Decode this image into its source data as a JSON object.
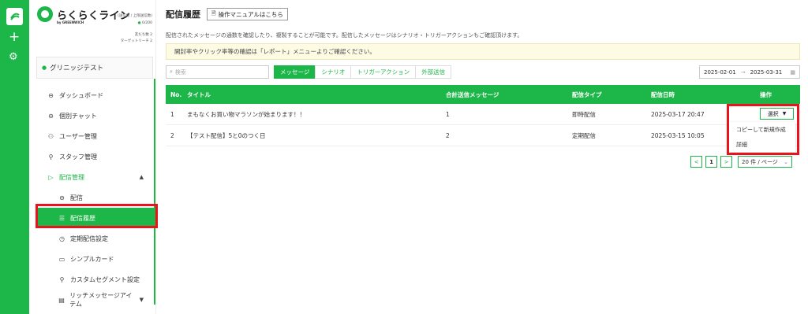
{
  "rail": {
    "logo_text": "GREENWICH",
    "plus_icon": "+",
    "gear_icon": "⚙"
  },
  "brand": {
    "name": "らくらくライン",
    "sub": "by GREENWICH"
  },
  "account": {
    "label_line1": "(送信数 / 上限送信数)",
    "quota": "0/200",
    "friends_label": "友だち数 2",
    "target_label": "ターゲットリーチ 2"
  },
  "workspace": "グリニッジテスト",
  "menu": [
    {
      "label": "ダッシュボード",
      "icon": "⊖"
    },
    {
      "label": "個別チャット",
      "icon": "⊖"
    },
    {
      "label": "ユーザー管理",
      "icon": "⚇"
    },
    {
      "label": "スタッフ管理",
      "icon": "⚲"
    },
    {
      "label": "配信管理",
      "icon": "▷"
    },
    {
      "label": "配信",
      "icon": "⊖"
    },
    {
      "label": "配信履歴",
      "icon": "☰"
    },
    {
      "label": "定期配信設定",
      "icon": "◷"
    },
    {
      "label": "シンプルカード",
      "icon": "▭"
    },
    {
      "label": "カスタムセグメント設定",
      "icon": "⚲"
    },
    {
      "label": "リッチメッセージアイテム",
      "icon": "▤"
    }
  ],
  "page": {
    "title": "配信履歴",
    "manual_button": "操作マニュアルはこちら",
    "description": "配信されたメッセージの通数を確認したり、複製することが可能です。配信したメッセージはシナリオ・トリガーアクションもご確認頂けます。",
    "notice": "開封率やクリック率等の確認は「レポート」メニューよりご確認ください。"
  },
  "search": {
    "placeholder": "検索"
  },
  "tabs": [
    "メッセージ",
    "シナリオ",
    "トリガーアクション",
    "外部送信"
  ],
  "daterange": {
    "start": "2025-02-01",
    "end": "2025-03-31"
  },
  "table": {
    "headers": {
      "no": "No.",
      "title": "タイトル",
      "count": "合計送信メッセージ",
      "type": "配信タイプ",
      "date": "配信日時",
      "op": "操作"
    },
    "rows": [
      {
        "no": "1",
        "title": "まもなくお買い物マラソンが始まります！！",
        "count": "1",
        "type": "即時配信",
        "date": "2025-03-17 20:47"
      },
      {
        "no": "2",
        "title": "【テスト配信】5と0のつく日",
        "count": "2",
        "type": "定期配信",
        "date": "2025-03-15 10:05"
      }
    ],
    "select_button": "選択"
  },
  "dropdown": [
    "コピーして新規作成",
    "詳細"
  ],
  "pager": {
    "prev": "<",
    "current": "1",
    "next": ">",
    "page_size": "20 件 / ページ"
  },
  "colors": {
    "accent": "#1db648",
    "highlight": "#e8131b",
    "notice_bg": "#fdfbe3"
  }
}
